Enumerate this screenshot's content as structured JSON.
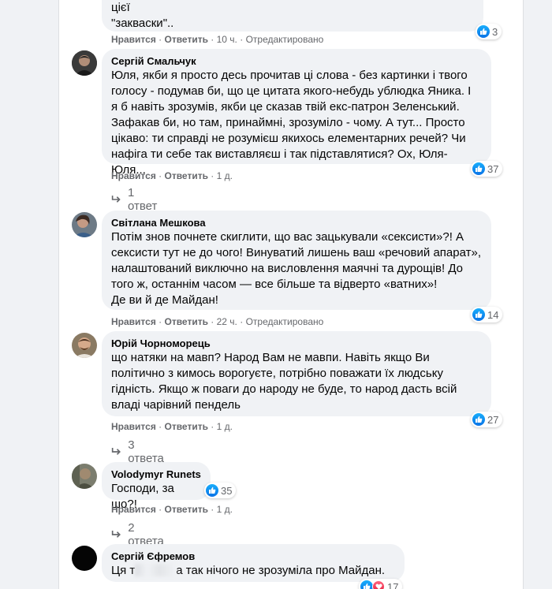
{
  "comments": [
    {
      "author": "",
      "text": "мендель,безугла,арахамія,юраш,третьякова...і звичайно ж Зе із цієї\n\"закваски\"..",
      "like": "Нравится",
      "reply": "Ответить",
      "time": "10 ч.",
      "edited": "Отредактировано",
      "reactions": "3"
    },
    {
      "author": "Сергій Смальчук",
      "text": "Юля, якби я просто десь прочитав ці слова - без картинки і твого\nголосу - подумав би, що це цитата якого-небудь ублюдка Яника. І\nя б навіть зрозумів, якби це сказав твій екс-патрон Зеленський.\nЗафакав би, но там, принаймні, зрозуміло - чому. А тут... Просто\nцікаво: ти справді не розумієш якихось елементарних речей? Чи\nнафіга ти себе так виставляєш і так підставлятися? Ох, Юля-Юля...",
      "like": "Нравится",
      "reply": "Ответить",
      "time": "1 д.",
      "reactions": "37",
      "replies": "1 ответ"
    },
    {
      "author": "Світлана Мешкова",
      "text": "Потім знов почнете скиглити, що вас зацькували «сексисти»?! А\nсексисти тут не до чого! Винуватий лишень ваш «речовий апарат»,\nналаштований виключно на висловлення маячні та дурощів! До\nтого ж, останнім часом — все більше та відверто «ватних»!\nДе ви й де Майдан!",
      "like": "Нравится",
      "reply": "Ответить",
      "time": "22 ч.",
      "edited": "Отредактировано",
      "reactions": "14"
    },
    {
      "author": "Юрій Чорноморець",
      "text": "що натяки на мавп? Народ Вам не мавпи. Навіть якщо Ви\nполітично з кимось ворогуєте, потрібно поважати їх людську\nгідність. Якщо ж поваги до народу не буде, то народ дасть всій\nвладі чарівний пендель",
      "like": "Нравится",
      "reply": "Ответить",
      "time": "1 д.",
      "reactions": "27",
      "replies": "3 ответа"
    },
    {
      "author": "Volodymyr Runets",
      "text": "Господи, за шо?!",
      "like": "Нравится",
      "reply": "Ответить",
      "time": "1 д.",
      "reactions": "35",
      "replies": "2 ответа"
    },
    {
      "author": "Сергій Єфремов",
      "text_before": "Ця т",
      "text_after": "а так нічого не зрозуміла про Майдан.",
      "reactions": "17"
    }
  ],
  "colors": {
    "like": "#0a72e6",
    "love": "#e61e3c",
    "bubble": "#f0f2f5",
    "meta": "#65676b"
  }
}
